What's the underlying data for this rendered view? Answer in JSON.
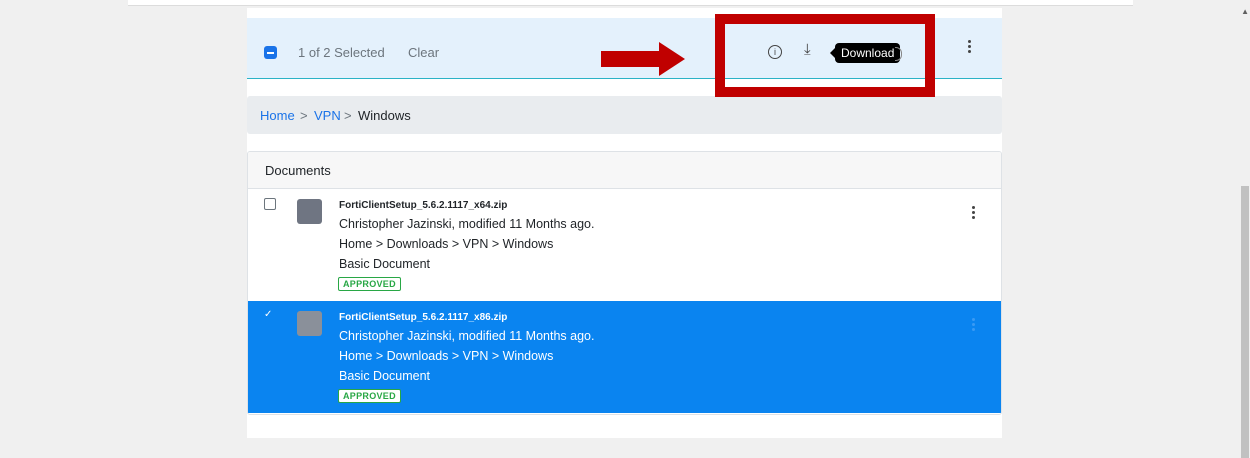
{
  "selection_bar": {
    "count_text": "1 of 2 Selected",
    "clear_label": "Clear",
    "info_glyph": "i",
    "download_glyph": "⤓",
    "download_tooltip": "Download"
  },
  "breadcrumb": {
    "items": [
      "Home",
      "VPN",
      "Windows"
    ],
    "separator": ">"
  },
  "documents": {
    "title": "Documents",
    "rows": [
      {
        "filename": "FortiClientSetup_5.6.2.1117_x64.zip",
        "author_line": "Christopher Jazinski, modified 11 Months ago.",
        "path": "Home > Downloads > VPN > Windows",
        "type": "Basic Document",
        "status": "APPROVED",
        "selected": false
      },
      {
        "filename": "FortiClientSetup_5.6.2.1117_x86.zip",
        "author_line": "Christopher Jazinski, modified 11 Months ago.",
        "path": "Home > Downloads > VPN > Windows",
        "type": "Basic Document",
        "status": "APPROVED",
        "selected": true,
        "check_glyph": "✓"
      }
    ]
  },
  "colors": {
    "selection_bar_bg": "#e4f1fc",
    "selected_row_bg": "#0a84f0",
    "link": "#1a73e8",
    "approved": "#28a745",
    "annotation_red": "#c00000"
  },
  "icons": [
    "minus-checkbox-icon",
    "info-icon",
    "download-icon",
    "kebab-menu-icon",
    "checkbox-icon",
    "document-thumbnail-icon",
    "red-arrow-annotation",
    "red-box-annotation"
  ]
}
